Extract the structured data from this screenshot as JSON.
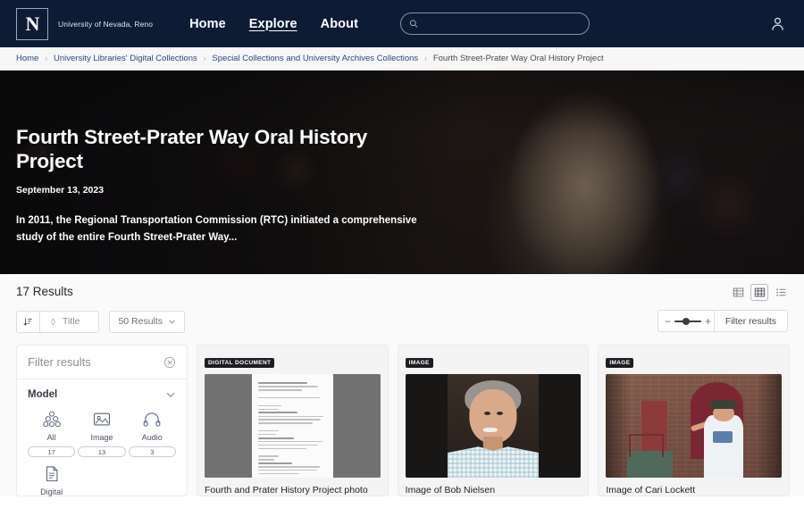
{
  "theme": {
    "navy": "#0d1b35",
    "page_bg": "#fafafa",
    "link_blue": "#2a4a77",
    "badge_bg": "#1d1d22"
  },
  "topnav": {
    "logo_letter": "N",
    "logo_text": "University of Nevada, Reno",
    "links": [
      {
        "label": "Home",
        "underlined": false
      },
      {
        "label": "Explore",
        "underlined": true
      },
      {
        "label": "About",
        "underlined": false
      }
    ],
    "search": {
      "value": "",
      "placeholder": ""
    },
    "account_icon": "user-icon",
    "search_icon": "search-icon"
  },
  "breadcrumb": {
    "items": [
      {
        "label": "Home"
      },
      {
        "label": "University Libraries' Digital Collections"
      },
      {
        "label": "Special Collections and University Archives Collections"
      },
      {
        "label": "Fourth Street-Prater Way Oral History Project"
      }
    ],
    "separator": "›"
  },
  "hero": {
    "title": "Fourth Street-Prater Way Oral History Project",
    "date": "September 13, 2023",
    "description": "In 2011, the Regional Transportation Commission (RTC) initiated a comprehensive study of the entire Fourth Street-Prater Way..."
  },
  "toolbar": {
    "results_count": "17 Results",
    "sort_direction_icon": "sort-descending-icon",
    "sort_field_label": "Title",
    "sort_field_icon": "sort-field-icon",
    "page_size_label": "50 Results",
    "page_size_chevron": "chevron-down-icon",
    "zoom_minus": "−",
    "zoom_plus": "+",
    "filter_button_label": "Filter results",
    "view_modes": [
      {
        "name": "table-view",
        "icon": "table-icon",
        "active": false
      },
      {
        "name": "grid-view",
        "icon": "grid-icon",
        "active": true
      },
      {
        "name": "list-view",
        "icon": "list-icon",
        "active": false
      }
    ]
  },
  "facets": {
    "panel_title": "Filter results",
    "close_icon": "close-circle-icon",
    "section": {
      "title": "Model",
      "chevron": "chevron-down-icon",
      "items": [
        {
          "label": "All",
          "count": "17",
          "icon": "all-models-icon"
        },
        {
          "label": "Image",
          "count": "13",
          "icon": "image-icon"
        },
        {
          "label": "Audio",
          "count": "3",
          "icon": "headphones-icon"
        },
        {
          "label": "Digital",
          "count": "",
          "icon": "document-icon"
        }
      ]
    }
  },
  "results": {
    "cards": [
      {
        "badge": "DIGITAL DOCUMENT",
        "title": "Fourth and Prater History Project photo guide",
        "thumb_type": "document"
      },
      {
        "badge": "IMAGE",
        "title": "Image of Bob Nielsen",
        "thumb_type": "portrait"
      },
      {
        "badge": "IMAGE",
        "title": "Image of Cari Lockett",
        "thumb_type": "brick"
      }
    ]
  }
}
